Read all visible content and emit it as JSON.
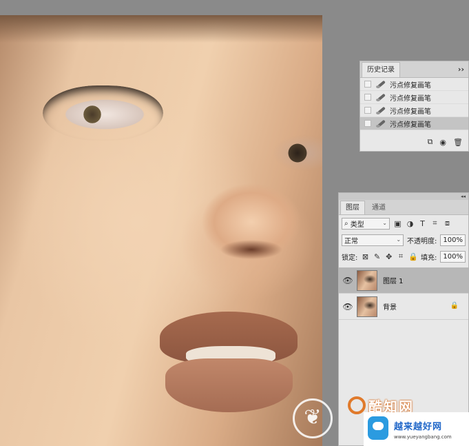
{
  "history_panel": {
    "tab_active": "历史记录",
    "menu_icon": "double-chevron-right-icon",
    "entries": [
      {
        "label": "污点修复画笔",
        "selected": false
      },
      {
        "label": "污点修复画笔",
        "selected": false
      },
      {
        "label": "污点修复画笔",
        "selected": false
      },
      {
        "label": "污点修复画笔",
        "selected": true
      }
    ],
    "footer_icons": [
      "new-document-icon",
      "camera-icon",
      "trash-icon"
    ]
  },
  "layers_panel": {
    "tabs": [
      "图层",
      "通道"
    ],
    "filter": {
      "kind_value": "类型"
    },
    "blend_mode": "正常",
    "opacity_label": "不透明度:",
    "opacity_value": "100%",
    "lock_label": "锁定:",
    "fill_label": "填充:",
    "fill_value": "100%",
    "layers": [
      {
        "name": "图层 1",
        "selected": true,
        "locked": false
      },
      {
        "name": "背景",
        "selected": false,
        "locked": true
      }
    ]
  },
  "watermark": {
    "text": "酷知网",
    "badge_title": "越来越好网",
    "badge_url": "www.yueyangbang.com"
  },
  "colors": {
    "app_background": "#8a8a8a",
    "panel_background": "#e8e8e8",
    "selected_row": "#c4c4c4",
    "watermark_accent": "#e07a2b",
    "badge_blue": "#1f66c8"
  }
}
